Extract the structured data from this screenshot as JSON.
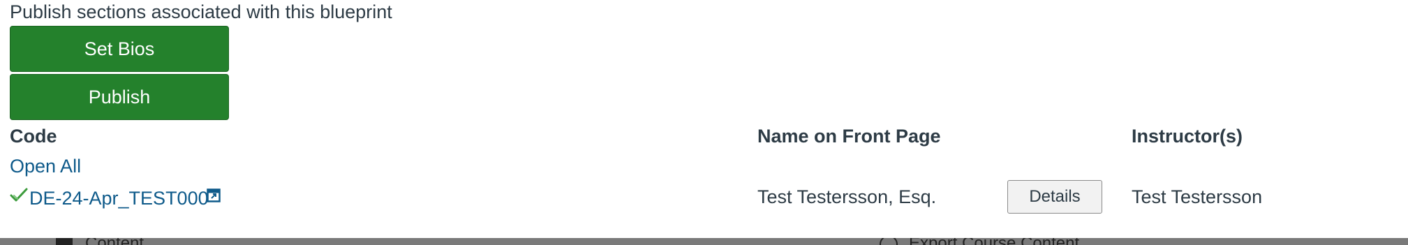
{
  "header": {
    "title": "Publish sections associated with this blueprint"
  },
  "actions": {
    "set_bios_label": "Set Bios",
    "publish_label": "Publish"
  },
  "table": {
    "columns": [
      "Code",
      "Name on Front Page",
      "Instructor(s)"
    ],
    "open_all_label": "Open All",
    "rows": [
      {
        "status": "published",
        "code": "DE-24-Apr_TEST000",
        "name_on_front_page": "Test Testersson, Esq.",
        "details_label": "Details",
        "instructors": "Test Testersson"
      }
    ]
  },
  "footer_partial": {
    "left_label": "Content",
    "right_label": "Export Course Content"
  },
  "colors": {
    "primary_button": "#24812c",
    "link": "#0e5a8a",
    "text": "#2d3b45",
    "check": "#3c9b3c"
  },
  "icons": {
    "status": "check-icon",
    "external": "external-link-icon"
  }
}
